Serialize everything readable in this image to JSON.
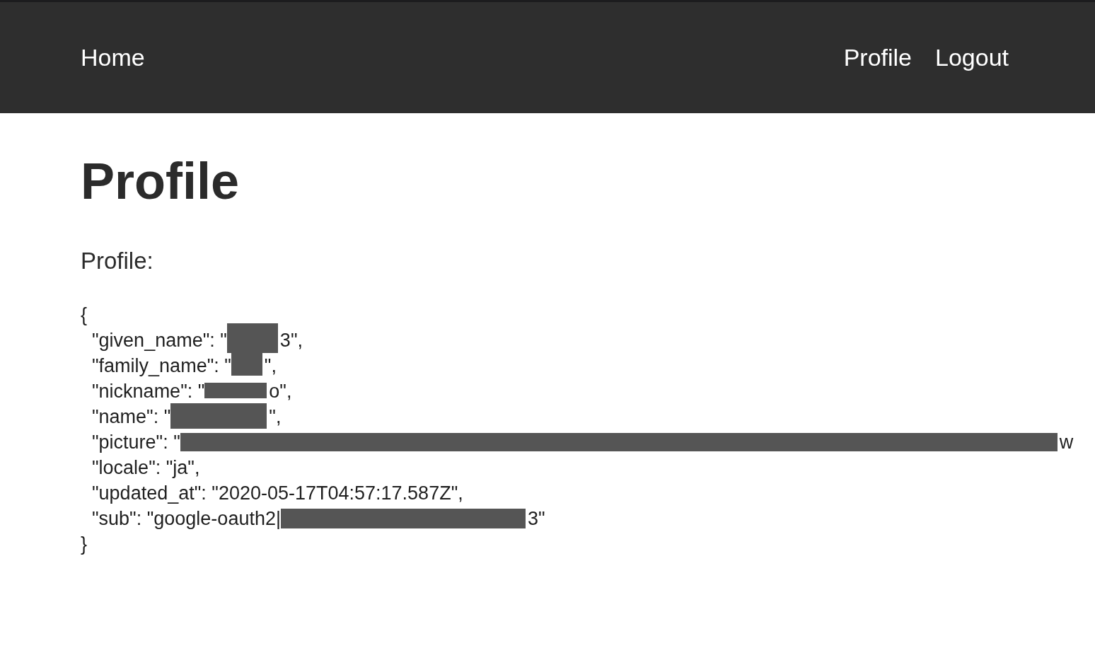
{
  "navbar": {
    "brand": "Home",
    "links": [
      "Profile",
      "Logout"
    ]
  },
  "page": {
    "heading": "Profile",
    "label": "Profile:"
  },
  "profile_json": {
    "open": "{",
    "lines": [
      {
        "text": "\"given_name\": \"",
        "redacted": true,
        "after": "3\","
      },
      {
        "text": "\"family_name\": \"",
        "redacted": true,
        "after": "\","
      },
      {
        "text": "\"nickname\": \"",
        "redacted": true,
        "after": "o\","
      },
      {
        "text": "\"name\": \"",
        "redacted": true,
        "after": "\","
      },
      {
        "text": "\"picture\": \"",
        "redacted": true,
        "after": "w"
      },
      {
        "text": "\"locale\": \"ja\",",
        "redacted": false
      },
      {
        "text": "\"updated_at\": \"2020-05-17T04:57:17.587Z\",",
        "redacted": false
      },
      {
        "text": "\"sub\": \"google-oauth2|",
        "redacted": true,
        "after": "3\""
      }
    ],
    "close": "}"
  }
}
